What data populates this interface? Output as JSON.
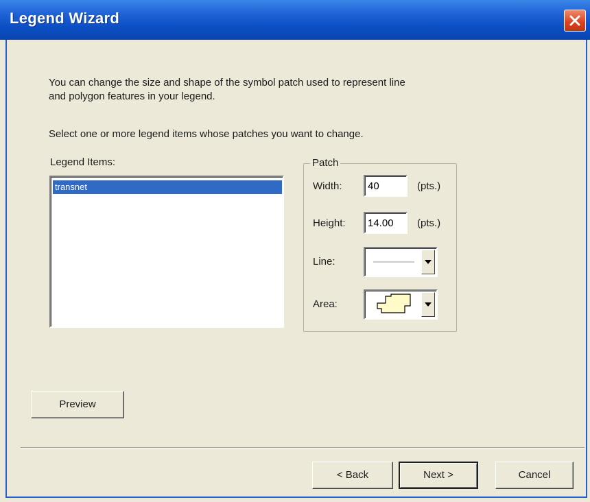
{
  "window": {
    "title": "Legend Wizard",
    "close_icon": "close-icon"
  },
  "intro": {
    "line1": "You can change the size and shape of the symbol patch used to represent line",
    "line2": "and polygon features in your legend.",
    "select_prompt": "Select one or more legend items whose patches you want to change."
  },
  "legend_items": {
    "label": "Legend Items:",
    "items": [
      "transnet"
    ],
    "selected": "transnet"
  },
  "patch": {
    "group_label": "Patch",
    "width_label": "Width:",
    "width_value": "40",
    "width_unit": "(pts.)",
    "height_label": "Height:",
    "height_value": "14.00",
    "height_unit": "(pts.)",
    "line_label": "Line:",
    "line_icon": "line-patch-icon",
    "area_label": "Area:",
    "area_icon": "area-patch-icon",
    "area_fill": "#fffbc8"
  },
  "buttons": {
    "preview": "Preview",
    "back": "< Back",
    "next": "Next >",
    "cancel": "Cancel"
  },
  "colors": {
    "titlebar": "#0b4ec3",
    "selection": "#316ac5",
    "dialog_bg": "#ece9d8",
    "close": "#d9411f"
  }
}
